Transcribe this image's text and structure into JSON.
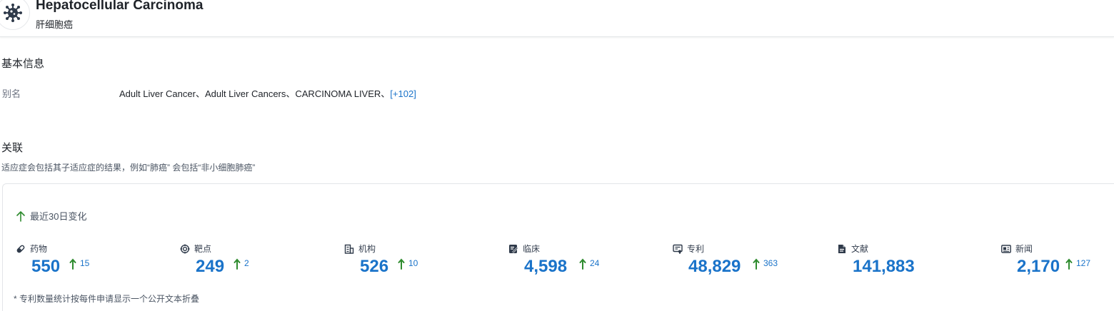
{
  "header": {
    "title": "Hepatocellular Carcinoma",
    "subtitle": "肝细胞癌",
    "avatar_icon": "virus-icon"
  },
  "basic_info": {
    "section_title": "基本信息",
    "alias_label": "别名",
    "alias_value": "Adult Liver Cancer、Adult Liver Cancers、CARCINOMA LIVER、",
    "alias_more": "[+102]"
  },
  "related": {
    "section_title": "关联",
    "hint": "适应症会包括其子适应症的结果，例如“肺癌” 会包括“非小细胞肺癌”",
    "change_label": "最近30日变化",
    "stats": [
      {
        "label": "药物",
        "icon": "pill-icon",
        "value": "550",
        "delta": "15"
      },
      {
        "label": "靶点",
        "icon": "target-icon",
        "value": "249",
        "delta": "2"
      },
      {
        "label": "机构",
        "icon": "building-icon",
        "value": "526",
        "delta": "10"
      },
      {
        "label": "临床",
        "icon": "clinical-icon",
        "value": "4,598",
        "delta": "24"
      },
      {
        "label": "专利",
        "icon": "patent-icon",
        "value": "48,829",
        "delta": "363"
      },
      {
        "label": "文献",
        "icon": "document-icon",
        "value": "141,883",
        "delta": ""
      },
      {
        "label": "新闻",
        "icon": "news-icon",
        "value": "2,170",
        "delta": "127"
      }
    ],
    "footnote": "* 专利数量统计按每件申请显示一个公开文本折叠"
  },
  "colors": {
    "accent": "#1a73c9",
    "up_arrow": "#2e8b2e"
  }
}
